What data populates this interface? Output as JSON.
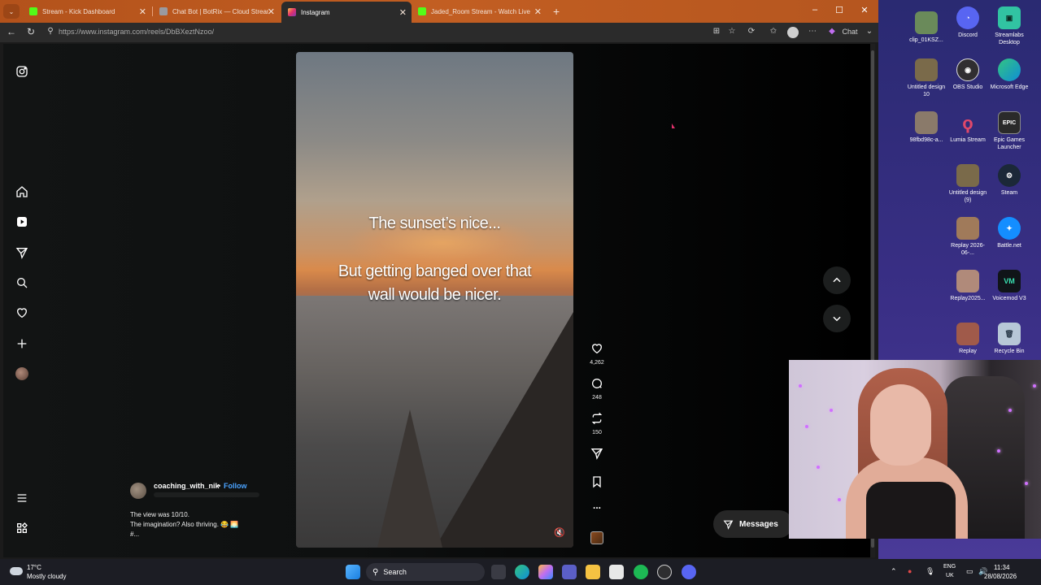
{
  "browser": {
    "tabs": [
      {
        "label": "Stream - Kick Dashboard",
        "favicon_color": "#53fc18"
      },
      {
        "label": "Chat Bot | BotRix — Cloud Stream",
        "favicon_color": "#9a9aa0"
      },
      {
        "label": "Instagram",
        "favicon_color": "#e1306c"
      },
      {
        "label": "Jaded_Room Stream - Watch Live",
        "favicon_color": "#53fc18"
      }
    ],
    "new_tab": "+",
    "url": "https://www.instagram.com/reels/DbBXeztNzoo/",
    "chat_label": "Chat",
    "window_controls": {
      "minimize": "–",
      "maximize": "☐",
      "close": "✕"
    }
  },
  "instagram": {
    "caption_line1": "The sunset’s nice...",
    "caption_line2": "But getting banged over that",
    "caption_line3": "wall would be nicer.",
    "actions": {
      "likes": "4,262",
      "comments": "248",
      "reposts": "150"
    },
    "author": "coaching_with_nik",
    "follow_sep": "•",
    "follow_label": "Follow",
    "description_line1": "The view was 10/10.",
    "description_line2": "The imagination? Also thriving. 😂 🌅",
    "description_line3": "#...",
    "more": "...",
    "messages_label": "Messages",
    "colors": {
      "accent": "#4aa3ff",
      "background": "#000000"
    }
  },
  "desktop": {
    "icons": [
      {
        "label": "clip_01KSZ...",
        "color": "#6a8a5a"
      },
      {
        "label": "Discord",
        "color": "#5865f2"
      },
      {
        "label": "Streamlabs Desktop",
        "color": "#31c3a2"
      },
      {
        "label": "Untitled design 10",
        "color": "#7a6a4a"
      },
      {
        "label": "OBS Studio",
        "color": "#302e31"
      },
      {
        "label": "Microsoft Edge",
        "color": "#0f8ed6"
      },
      {
        "label": "98fbd98c-a...",
        "color": "#8a7a6a"
      },
      {
        "label": "Lumia Stream",
        "color": "#e0486a"
      },
      {
        "label": "Epic Games Launcher",
        "color": "#2a2a2a"
      },
      {
        "label": "Untitled design (9)",
        "color": "#7a6a4a"
      },
      {
        "label": "Steam",
        "color": "#1b2838"
      },
      {
        "label": "Replay 2026-06-...",
        "color": "#a07a5a"
      },
      {
        "label": "Battle.net",
        "color": "#148eff"
      },
      {
        "label": "Replay2025...",
        "color": "#b08a7a"
      },
      {
        "label": "Voicemod V3",
        "color": "#101418"
      },
      {
        "label": "Replay",
        "color": "#a05a4a"
      },
      {
        "label": "Recycle Bin",
        "color": "#b7c7d7"
      }
    ]
  },
  "taskbar": {
    "weather_temp": "17°C",
    "weather_desc": "Mostly cloudy",
    "search_label": "Search",
    "lang_line1": "ENG",
    "lang_line2": "UK",
    "time": "11:34",
    "date": "28/08/2026"
  }
}
